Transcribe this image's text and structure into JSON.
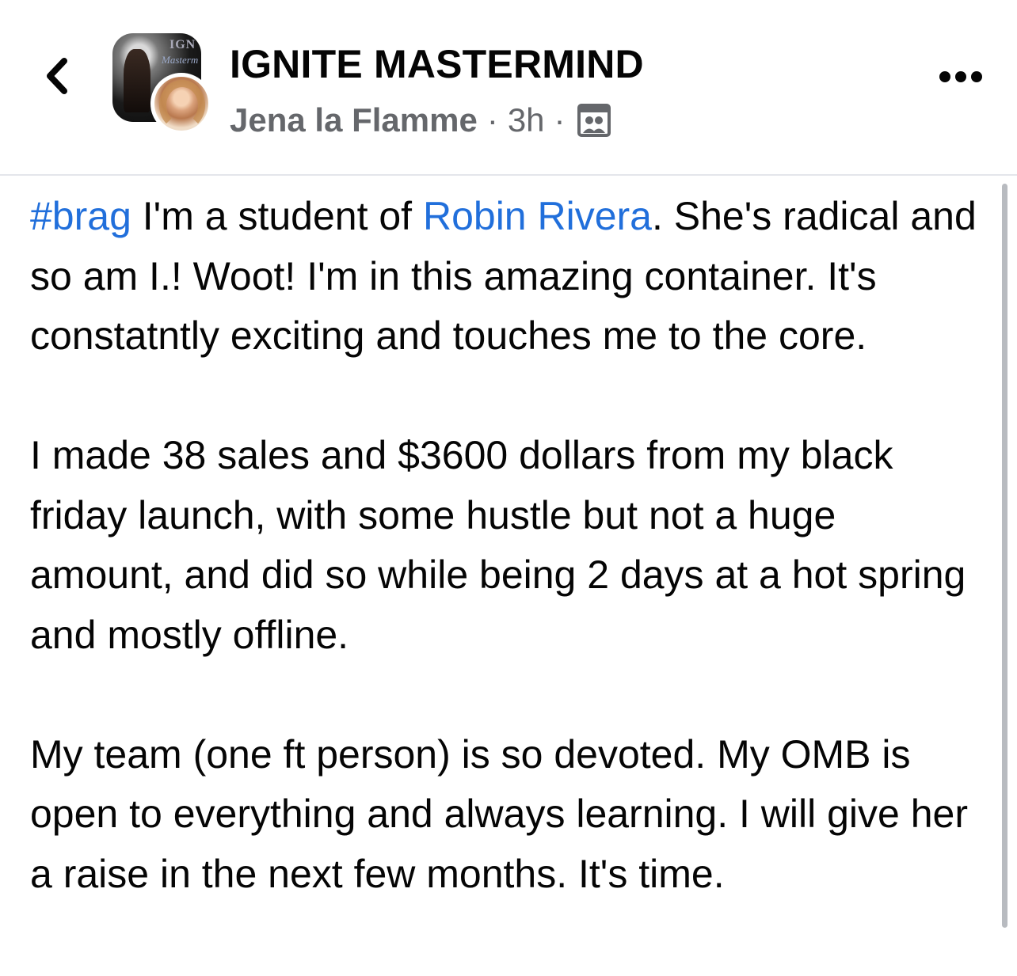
{
  "header": {
    "back_icon": "chevron-left-icon",
    "group_name": "IGNITE MASTERMIND",
    "group_avatar_text": "IGN",
    "group_avatar_script": "Masterm",
    "author": "Jena la Flamme",
    "separator": "·",
    "time": "3h",
    "privacy_icon": "group-members-icon",
    "more_icon": "more-dots-icon"
  },
  "post": {
    "paragraph1": {
      "hashtag": "#brag",
      "text_before_mention": " I'm a student of ",
      "mention": "Robin Rivera",
      "text_after_mention": ". She's radical and so am I.! Woot! I'm in this amazing container. It's constatntly exciting and touches me to the core."
    },
    "paragraph2": "I made 38 sales and $3600 dollars from my black friday launch, with some hustle but not a huge amount, and did so while being 2 days at a hot spring and mostly offline.",
    "paragraph3": "My team (one ft person) is so devoted. My OMB is open to everything and always learning. I will give her a raise in the next few months. It's time."
  },
  "colors": {
    "link": "#216fdb",
    "text": "#050505",
    "meta": "#65676b",
    "divider": "#e4e6eb"
  }
}
